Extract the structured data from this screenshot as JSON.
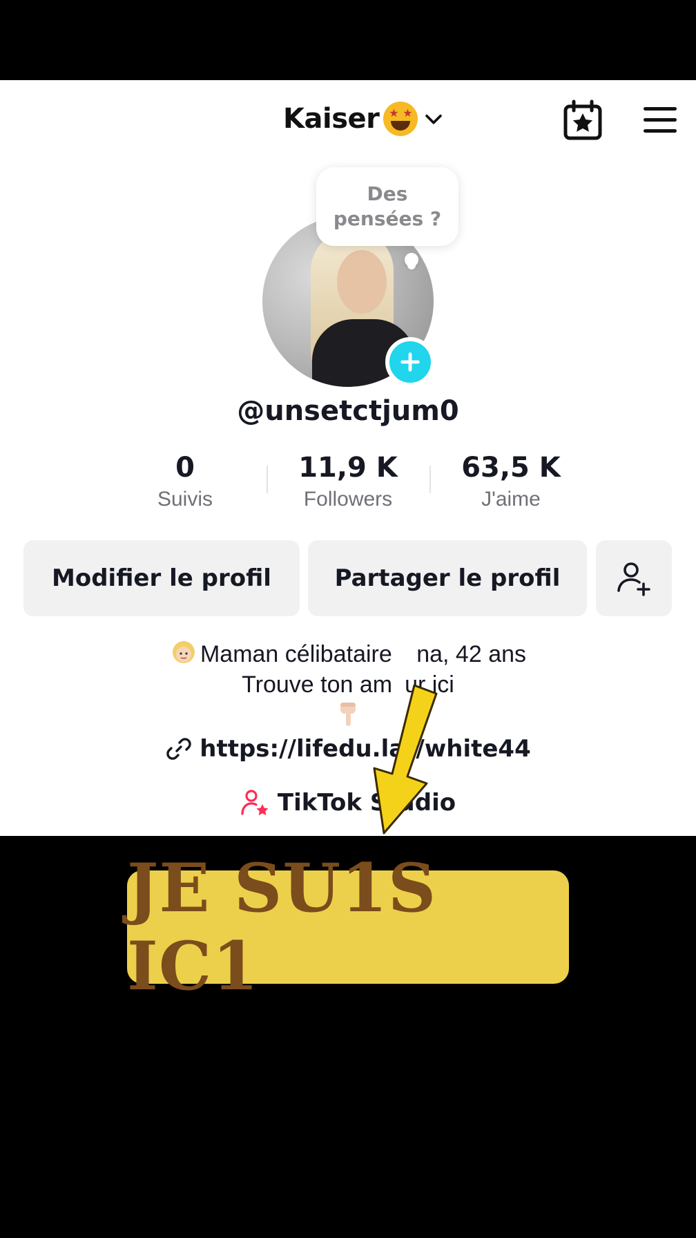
{
  "header": {
    "account_name": "Kaiser",
    "account_emoji": "star-struck-emoji-icon",
    "chevron": "chevron-down-icon",
    "calendar_icon": "calendar-star-icon",
    "menu_icon": "hamburger-menu-icon"
  },
  "bubble": {
    "text": "Des pensées ?"
  },
  "profile": {
    "username": "@unsetctjum0",
    "stats": [
      {
        "value": "0",
        "label": "Suivis"
      },
      {
        "value": "11,9 K",
        "label": "Followers"
      },
      {
        "value": "63,5 K",
        "label": "J'aime"
      }
    ]
  },
  "buttons": {
    "edit": "Modifier le profil",
    "share": "Partager le profil",
    "add_friend_icon": "add-friend-icon"
  },
  "bio": {
    "line1_before": "Maman célibataire",
    "line1_after": "na, 42 ans",
    "line2_before": "Trouve ton am",
    "line2_after": "ur ici"
  },
  "link": {
    "text": "https://lifedu.lat/white44"
  },
  "studio": {
    "label": "TikTok Studio"
  },
  "overlay": {
    "caption": "JE SU1S IC1",
    "arrow_color": "#f5d21a",
    "caption_bg": "#ecd04b",
    "caption_color": "#7b4c1c"
  },
  "colors": {
    "accent_cyan": "#20d5ec",
    "studio_pink": "#fe2c55"
  }
}
